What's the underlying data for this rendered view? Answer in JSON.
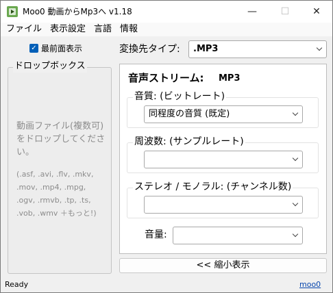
{
  "window": {
    "title": "Moo0 動画からMp3へ v1.18",
    "min_glyph": "—",
    "max_glyph": "☐",
    "close_glyph": "✕",
    "icon": "app-icon"
  },
  "menu": [
    "ファイル",
    "表示設定",
    "言語",
    "情報"
  ],
  "left": {
    "always_on_top": {
      "label": "最前面表示",
      "checked": true
    },
    "drop_box": {
      "title": "ドロップボックス",
      "message": "動画ファイル(複数可)をドロップしてください。",
      "extensions": "(.asf, .avi, .flv, .mkv, .mov, .mp4, .mpg, .ogv, .rmvb, .tp, .ts, .vob, .wmv ＋もっと!)"
    }
  },
  "right": {
    "conversion": {
      "label": "変換先タイプ:",
      "value": ".MP3"
    },
    "audio_stream": {
      "heading": "音声ストリーム:",
      "format": "MP3",
      "quality": {
        "label": "音質: (ビットレート)",
        "value": "同程度の音質 (既定)"
      },
      "frequency": {
        "label": "周波数: (サンプルレート)",
        "value": ""
      },
      "channels": {
        "label": "ステレオ / モノラル: (チャンネル数)",
        "value": ""
      },
      "volume": {
        "label": "音量:",
        "value": ""
      }
    },
    "shrink_button": "<< 縮小表示"
  },
  "status": {
    "text": "Ready",
    "link": "moo0"
  },
  "colors": {
    "accent": "#005fb8",
    "panel": "#ffffff",
    "background": "#f0f0f0",
    "link": "#0645ad"
  }
}
